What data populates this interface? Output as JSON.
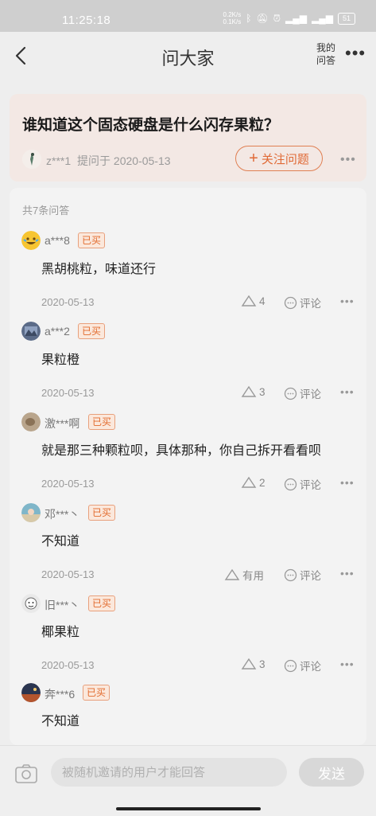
{
  "status_bar": {
    "time": "11:25:18",
    "net_up": "0.2K/s",
    "net_down": "0.1K/s",
    "battery": "51"
  },
  "header": {
    "title": "问大家",
    "my_qa_line1": "我的",
    "my_qa_line2": "问答",
    "more": "•••"
  },
  "question": {
    "title": "谁知道这个固态硬盘是什么闪存果粒？",
    "asker": "z***1",
    "asked_label": "提问于 2020-05-13",
    "follow_label": "关注问题",
    "more": "•••"
  },
  "answers_header": "共7条问答",
  "badge_label": "已买",
  "comment_label": "评论",
  "answers": [
    {
      "name": "a***8",
      "text": "黑胡桃粒，味道还行",
      "date": "2020-05-13",
      "likes": "4"
    },
    {
      "name": "a***2",
      "text": "果粒橙",
      "date": "2020-05-13",
      "likes": "3"
    },
    {
      "name": "激***啊",
      "text": "就是那三种颗粒呗，具体那种，你自己拆开看看呗",
      "date": "2020-05-13",
      "likes": "2"
    },
    {
      "name": "邓***丶",
      "text": "不知道",
      "date": "2020-05-13",
      "likes": "有用"
    },
    {
      "name": "旧***丶",
      "text": "椰果粒",
      "date": "2020-05-13",
      "likes": "3"
    },
    {
      "name": "奔***6",
      "text": "不知道",
      "date": "",
      "likes": ""
    }
  ],
  "bottom_bar": {
    "placeholder": "被随机邀请的用户才能回答",
    "send_label": "发送"
  },
  "colors": {
    "accent": "#e06a36",
    "question_bg": "#f3e8e4",
    "badge_bg": "#fbe8dc"
  }
}
